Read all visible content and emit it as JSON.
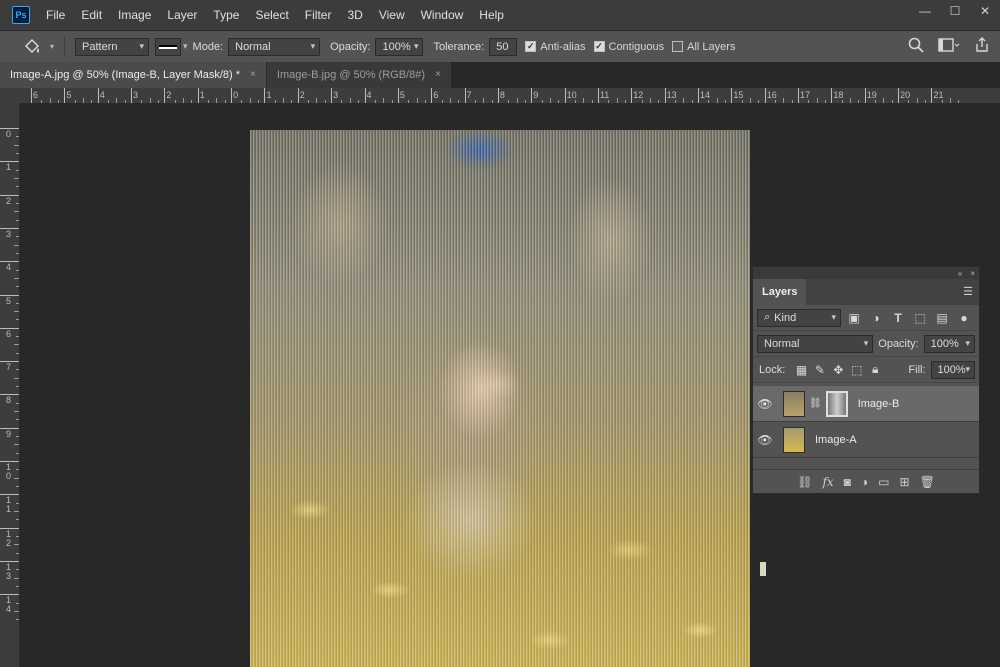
{
  "app": {
    "logo": "Ps"
  },
  "menu": [
    "File",
    "Edit",
    "Image",
    "Layer",
    "Type",
    "Select",
    "Filter",
    "3D",
    "View",
    "Window",
    "Help"
  ],
  "window_controls": {
    "minimize": "—",
    "maximize": "☐",
    "close": "✕"
  },
  "options": {
    "tool_icon": "paint-bucket-icon",
    "fill_source": "Pattern",
    "mode_label": "Mode:",
    "mode_value": "Normal",
    "opacity_label": "Opacity:",
    "opacity_value": "100%",
    "tolerance_label": "Tolerance:",
    "tolerance_value": "50",
    "antialias_label": "Anti-alias",
    "antialias_checked": true,
    "contiguous_label": "Contiguous",
    "contiguous_checked": true,
    "all_layers_label": "All Layers",
    "all_layers_checked": false
  },
  "tabs": [
    {
      "label": "Image-A.jpg @ 50% (Image-B, Layer Mask/8) *",
      "active": true,
      "close": "×"
    },
    {
      "label": "Image-B.jpg @ 50% (RGB/8#)",
      "active": false,
      "close": "×"
    }
  ],
  "ruler_top": [
    "6",
    "5",
    "4",
    "3",
    "2",
    "1",
    "0",
    "1",
    "2",
    "3",
    "4",
    "5",
    "6",
    "7",
    "8",
    "9",
    "10",
    "11",
    "12",
    "13",
    "14",
    "15",
    "16",
    "17",
    "18",
    "19",
    "20",
    "21"
  ],
  "ruler_left": [
    "0",
    "1",
    "2",
    "3",
    "4",
    "5",
    "6",
    "7",
    "8",
    "9",
    "10",
    "11",
    "12",
    "13",
    "14"
  ],
  "layers_panel": {
    "collapse": "«",
    "close": "×",
    "title": "Layers",
    "filter_kind": "Kind",
    "blend_mode": "Normal",
    "opacity_label": "Opacity:",
    "opacity_value": "100%",
    "lock_label": "Lock:",
    "fill_label": "Fill:",
    "fill_value": "100%",
    "layers": [
      {
        "name": "Image-B",
        "selected": true,
        "has_mask": true
      },
      {
        "name": "Image-A",
        "selected": false,
        "has_mask": false
      }
    ],
    "footer_fx": "fx"
  }
}
